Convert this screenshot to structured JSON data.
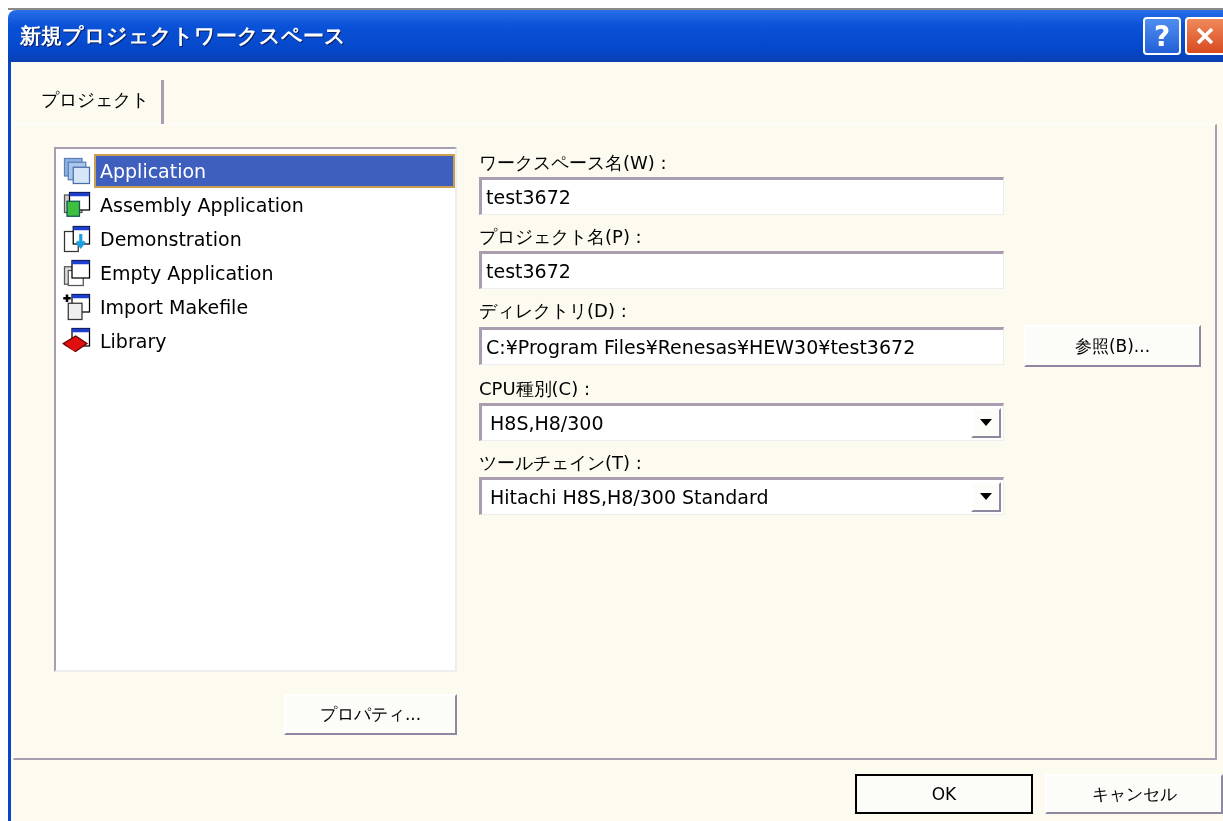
{
  "window": {
    "title": "新規プロジェクトワークスペース",
    "help_button": "?"
  },
  "tabs": [
    {
      "label": "プロジェクト",
      "selected": true
    }
  ],
  "project_types": [
    {
      "label": "Application",
      "kind": "application",
      "selected": true
    },
    {
      "label": "Assembly Application",
      "kind": "assembly",
      "selected": false
    },
    {
      "label": "Demonstration",
      "kind": "demo",
      "selected": false
    },
    {
      "label": "Empty Application",
      "kind": "empty",
      "selected": false
    },
    {
      "label": "Import Makefile",
      "kind": "import",
      "selected": false
    },
    {
      "label": "Library",
      "kind": "library",
      "selected": false
    }
  ],
  "properties_button": "プロパティ...",
  "fields": [
    {
      "label": "ワークスペース名(W) :",
      "value": "test3672",
      "kind": "text"
    },
    {
      "label": "プロジェクト名(P) :",
      "value": "test3672",
      "kind": "text"
    },
    {
      "label": "ディレクトリ(D) :",
      "value": "C:¥Program Files¥Renesas¥HEW30¥test3672",
      "kind": "browse",
      "button": "参照(B)..."
    },
    {
      "label": "CPU種別(C) :",
      "value": "H8S,H8/300",
      "kind": "dropdown"
    },
    {
      "label": "ツールチェイン(T) :",
      "value": "Hitachi H8S,H8/300 Standard",
      "kind": "dropdown"
    }
  ],
  "buttons": [
    {
      "label": "OK",
      "default": true
    },
    {
      "label": "キャンセル",
      "default": false
    }
  ]
}
